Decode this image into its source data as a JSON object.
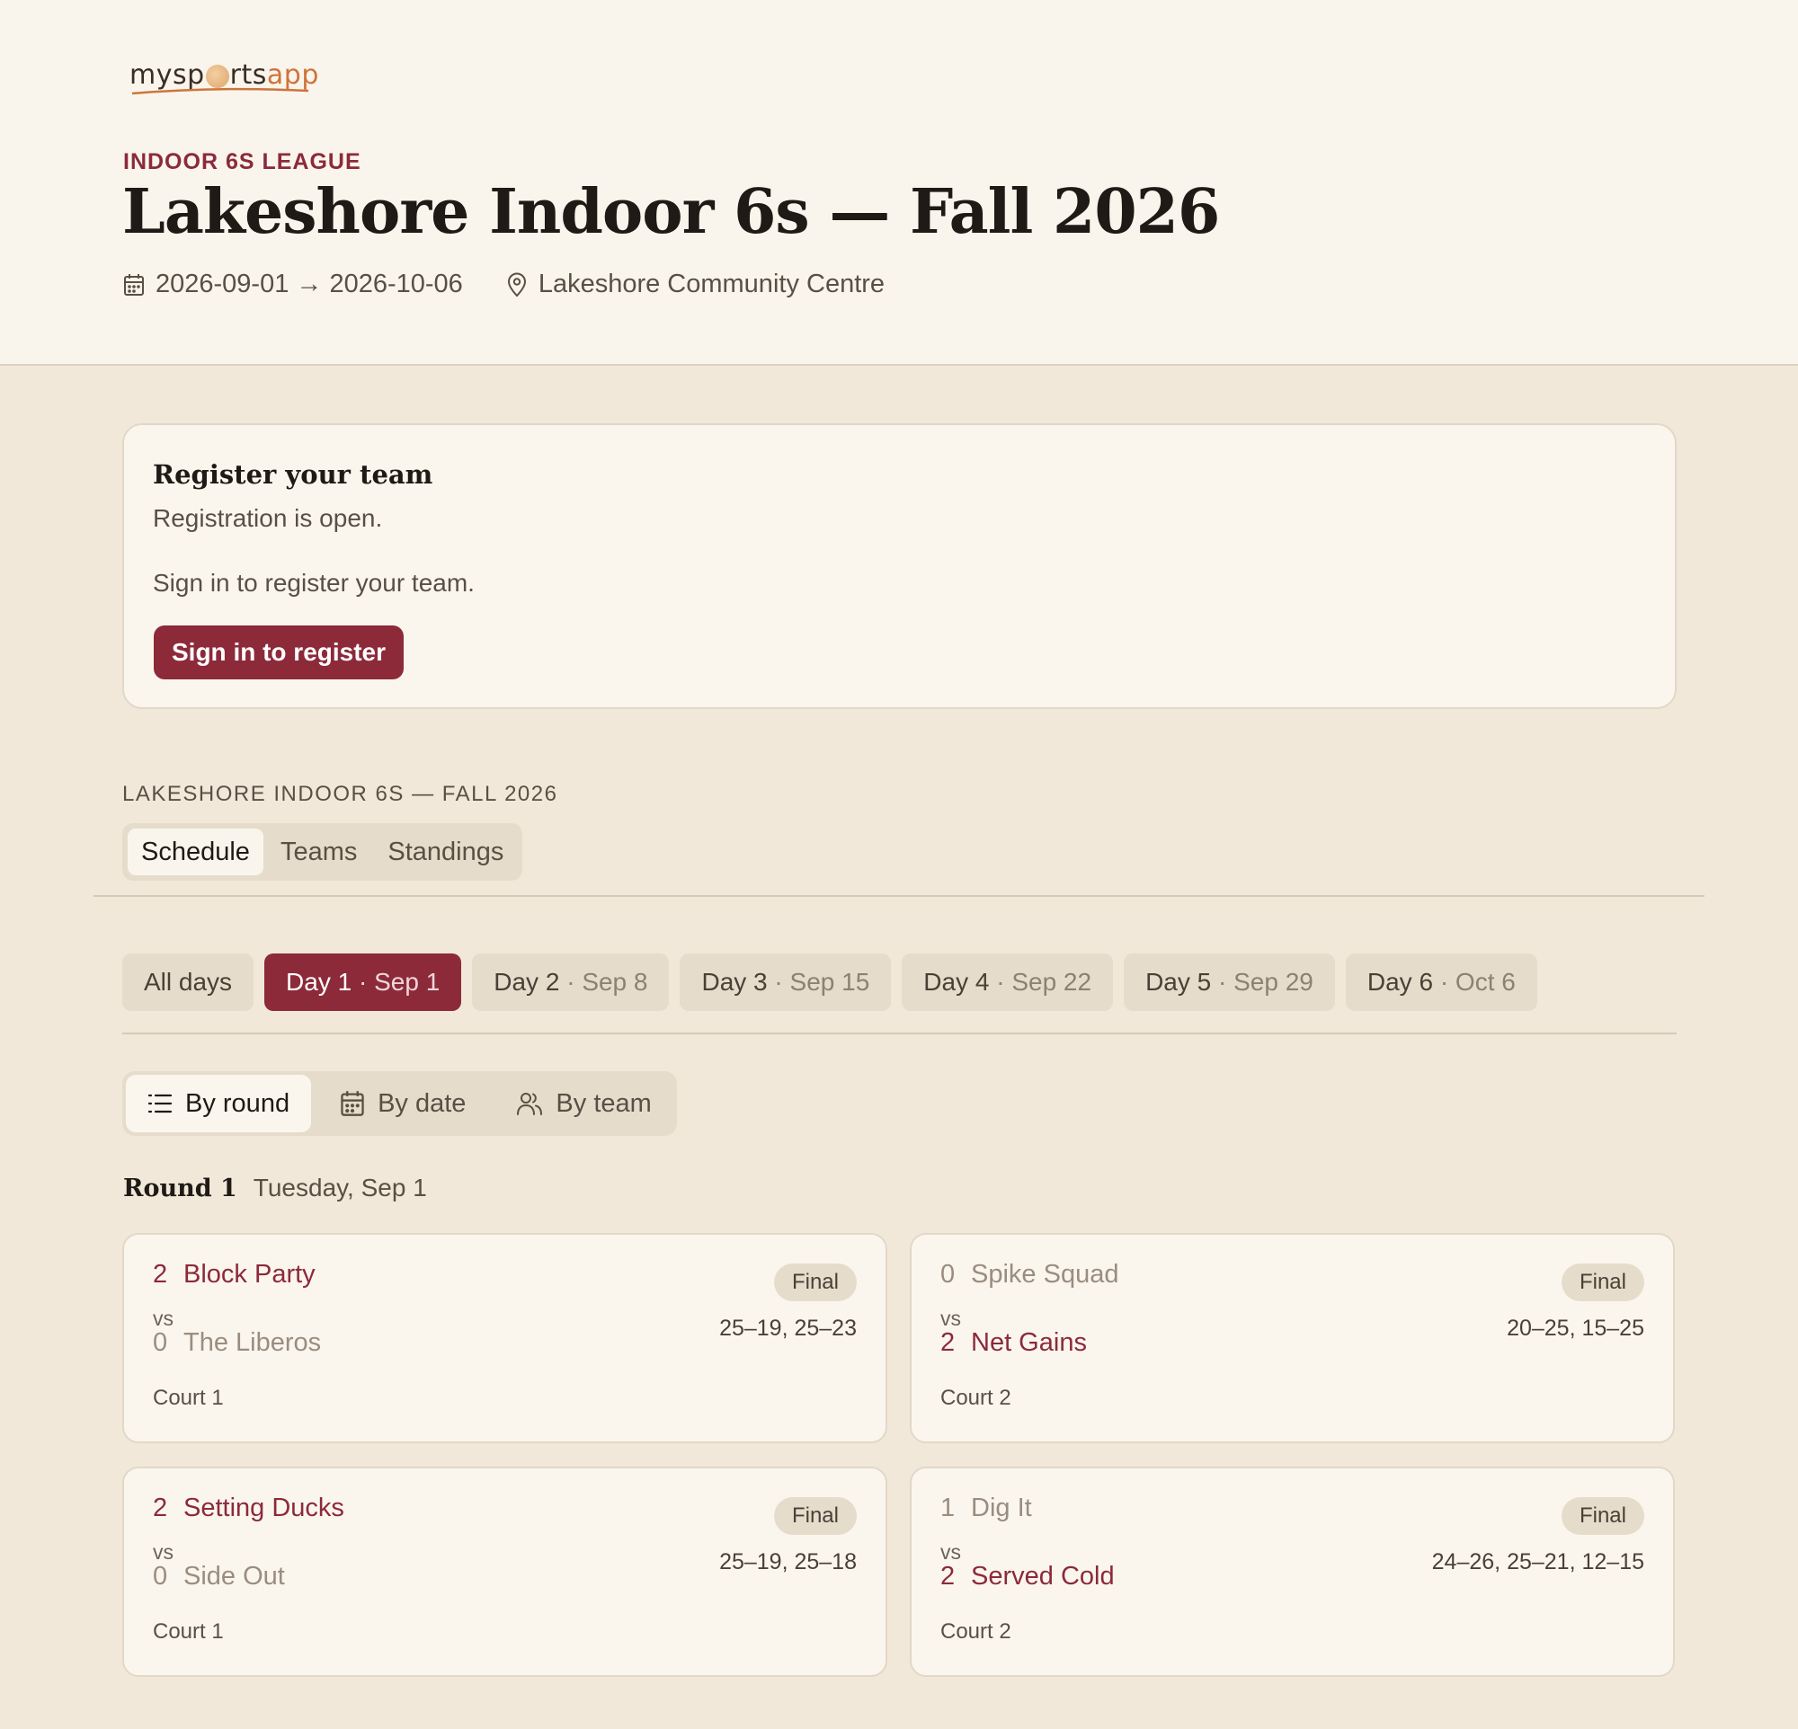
{
  "header": {
    "logo": {
      "part1": "mysp",
      "part2": "rts",
      "part3": "app"
    },
    "eyebrow": "INDOOR 6S LEAGUE",
    "title": "Lakeshore Indoor 6s — Fall 2026",
    "date_range": "2026-09-01 → 2026-10-06",
    "venue": "Lakeshore Community Centre"
  },
  "register": {
    "heading": "Register your team",
    "status": "Registration is open.",
    "prompt": "Sign in to register your team.",
    "button": "Sign in to register"
  },
  "league": {
    "label": "LAKESHORE INDOOR 6S — FALL 2026",
    "tabs": [
      "Schedule",
      "Teams",
      "Standings"
    ],
    "active_tab": "Schedule"
  },
  "days": [
    {
      "label": "All days",
      "date": ""
    },
    {
      "label": "Day 1",
      "date": "Sep 1",
      "active": true
    },
    {
      "label": "Day 2",
      "date": "Sep 8"
    },
    {
      "label": "Day 3",
      "date": "Sep 15"
    },
    {
      "label": "Day 4",
      "date": "Sep 22"
    },
    {
      "label": "Day 5",
      "date": "Sep 29"
    },
    {
      "label": "Day 6",
      "date": "Oct 6"
    }
  ],
  "day_separator": "·",
  "views": [
    {
      "label": "By round",
      "icon": "list-icon",
      "active": true
    },
    {
      "label": "By date",
      "icon": "calendar-icon"
    },
    {
      "label": "By team",
      "icon": "users-icon"
    }
  ],
  "round": {
    "name": "Round 1",
    "date": "Tuesday, Sep 1"
  },
  "vs_label": "vs",
  "matches": [
    {
      "home": {
        "score": "2",
        "team": "Block Party",
        "win": true
      },
      "away": {
        "score": "0",
        "team": "The Liberos",
        "win": false
      },
      "status": "Final",
      "sets": "25–19, 25–23",
      "court": "Court 1"
    },
    {
      "home": {
        "score": "0",
        "team": "Spike Squad",
        "win": false
      },
      "away": {
        "score": "2",
        "team": "Net Gains",
        "win": true
      },
      "status": "Final",
      "sets": "20–25, 15–25",
      "court": "Court 2"
    },
    {
      "home": {
        "score": "2",
        "team": "Setting Ducks",
        "win": true
      },
      "away": {
        "score": "0",
        "team": "Side Out",
        "win": false
      },
      "status": "Final",
      "sets": "25–19, 25–18",
      "court": "Court 1"
    },
    {
      "home": {
        "score": "1",
        "team": "Dig It",
        "win": false
      },
      "away": {
        "score": "2",
        "team": "Served Cold",
        "win": true
      },
      "status": "Final",
      "sets": "24–26, 25–21, 12–15",
      "court": "Court 2"
    }
  ],
  "colors": {
    "accent": "#8c2a3a",
    "header_bg": "#f9f5ec",
    "page_bg": "#f1e8da",
    "logo_accent": "#d0733a"
  }
}
